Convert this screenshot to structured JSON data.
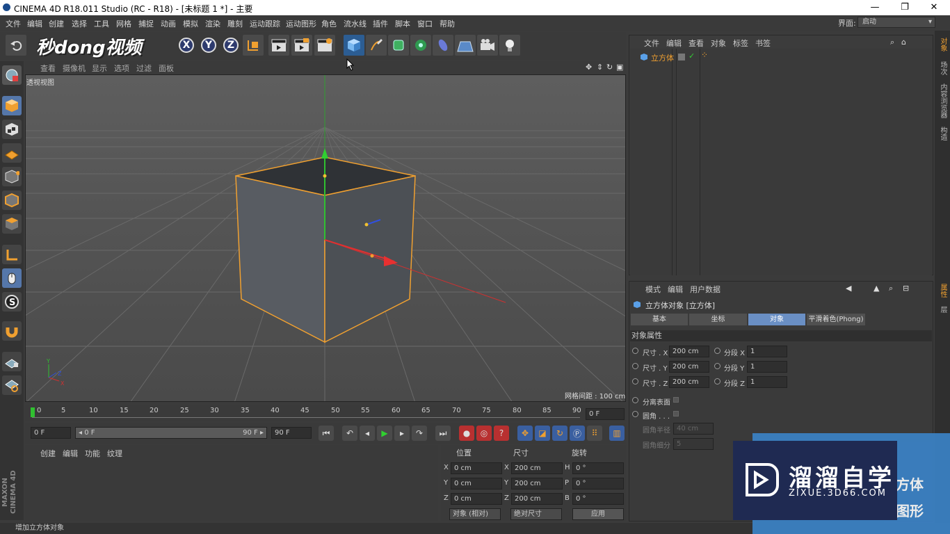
{
  "window": {
    "title": "CINEMA 4D R18.011 Studio (RC - R18) - [未标题 1 *] - 主要",
    "minimize": "—",
    "maximize": "❐",
    "close": "✕"
  },
  "menubar": {
    "items": [
      "文件",
      "编辑",
      "创建",
      "选择",
      "工具",
      "网格",
      "捕捉",
      "动画",
      "模拟",
      "渲染",
      "雕刻",
      "运动跟踪",
      "运动图形",
      "角色",
      "流水线",
      "插件",
      "脚本",
      "窗口",
      "帮助"
    ],
    "layout_label": "界面:",
    "layout_value": "启动"
  },
  "toolbar": {
    "overlay_text": "秒dong视频",
    "axis_x": "X",
    "axis_y": "Y",
    "axis_z": "Z"
  },
  "viewport": {
    "menu": [
      "查看",
      "摄像机",
      "显示",
      "选项",
      "过滤",
      "面板"
    ],
    "label": "透视视图",
    "grid_spacing": "网格间距 : 100 cm"
  },
  "timeline": {
    "ticks": [
      "0",
      "5",
      "10",
      "15",
      "20",
      "25",
      "30",
      "35",
      "40",
      "45",
      "50",
      "55",
      "60",
      "65",
      "70",
      "75",
      "80",
      "85",
      "90"
    ],
    "current_frame": "0 F",
    "start_field": "0 F",
    "range_start": "◂ 0 F",
    "range_end": "90 F ▸",
    "end_field": "90 F"
  },
  "material": {
    "menu": [
      "创建",
      "编辑",
      "功能",
      "纹理"
    ]
  },
  "coords": {
    "headers": [
      "位置",
      "尺寸",
      "旋转"
    ],
    "rows": [
      {
        "axis": "X",
        "pos": "0 cm",
        "saxis": "X",
        "size": "200 cm",
        "raxis": "H",
        "rot": "0 °"
      },
      {
        "axis": "Y",
        "pos": "0 cm",
        "saxis": "Y",
        "size": "200 cm",
        "raxis": "P",
        "rot": "0 °"
      },
      {
        "axis": "Z",
        "pos": "0 cm",
        "saxis": "Z",
        "size": "200 cm",
        "raxis": "B",
        "rot": "0 °"
      }
    ],
    "mode": "对象 (相对)",
    "size_mode": "绝对尺寸",
    "apply": "应用"
  },
  "brand": "MAXON CINEMA 4D",
  "status": "增加立方体对象",
  "object_manager": {
    "menu": [
      "文件",
      "编辑",
      "查看",
      "对象",
      "标签",
      "书签"
    ],
    "objects": [
      {
        "name": "立方体"
      }
    ]
  },
  "attributes": {
    "menu": [
      "模式",
      "编辑",
      "用户数据"
    ],
    "title": "立方体对象 [立方体]",
    "tabs": [
      "基本",
      "坐标",
      "对象",
      "平滑着色(Phong)"
    ],
    "selected_tab": "对象",
    "section": "对象属性",
    "rows": [
      {
        "label": "尺寸 . X",
        "value": "200 cm",
        "seg_label": "分段 X",
        "seg": "1"
      },
      {
        "label": "尺寸 . Y",
        "value": "200 cm",
        "seg_label": "分段 Y",
        "seg": "1"
      },
      {
        "label": "尺寸 . Z",
        "value": "200 cm",
        "seg_label": "分段 Z",
        "seg": "1"
      }
    ],
    "separate": "分离表面",
    "fillet": "圆角 . . .",
    "fillet_radius_label": "圆角半径",
    "fillet_radius": "40 cm",
    "fillet_sub_label": "圆角细分",
    "fillet_sub": "5"
  },
  "right_tabs": [
    "对象",
    "场次",
    "内容浏览器",
    "构造",
    "属性",
    "层"
  ],
  "watermark": {
    "name": "溜溜自学",
    "url": "ZIXUE.3D66.COM",
    "behind1": "方体",
    "behind2": "图形"
  },
  "colors": {
    "accent": "#6a8fc4",
    "selection": "#f0a030"
  }
}
